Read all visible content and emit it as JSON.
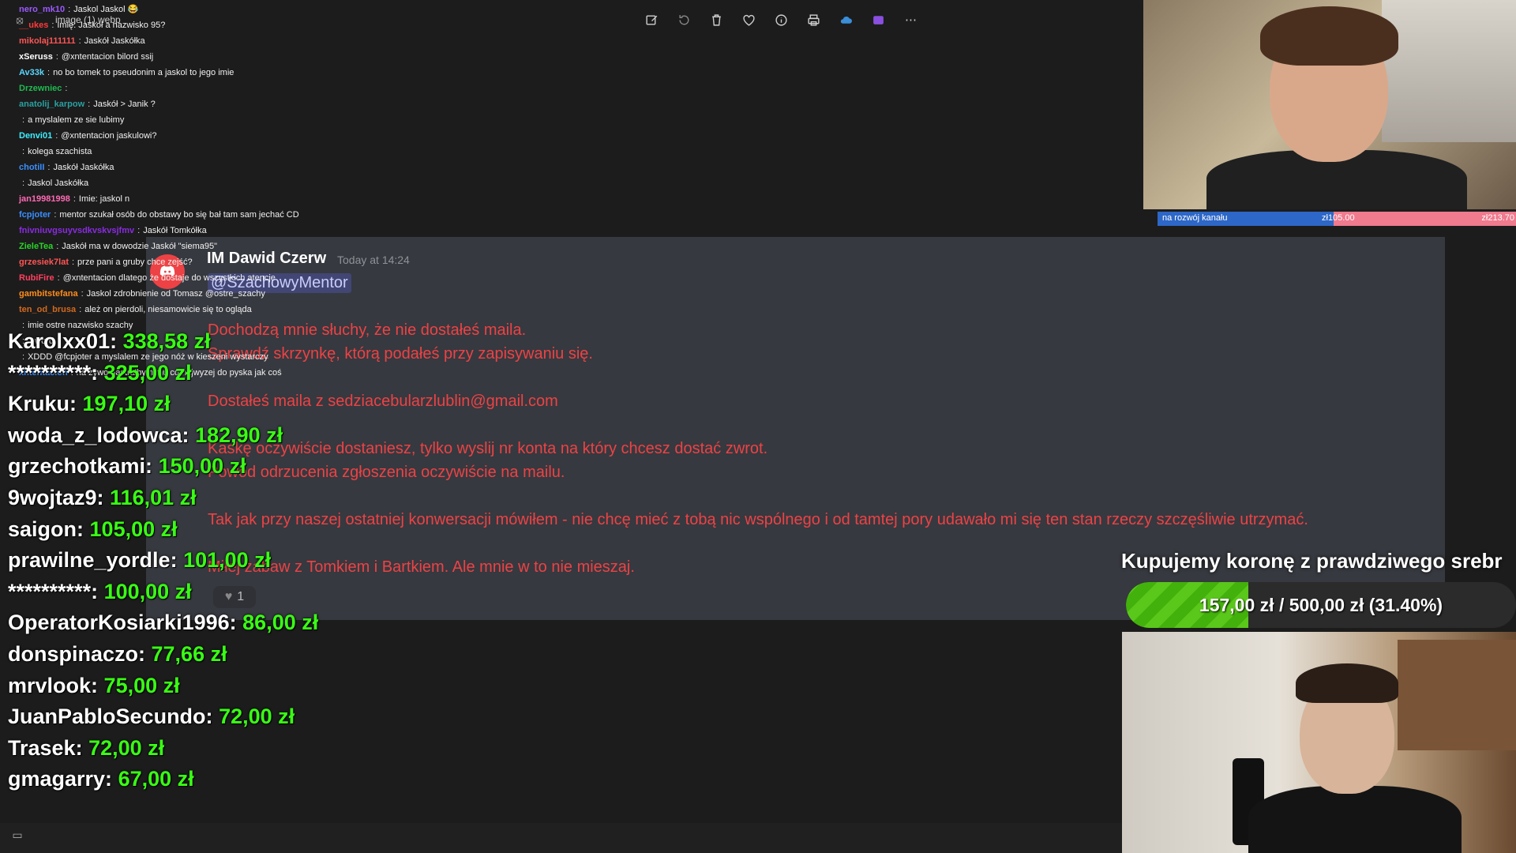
{
  "viewer": {
    "title": "image (1).webp",
    "toolbar": [
      "edit-icon",
      "rotate-icon",
      "delete-icon",
      "favorite-icon",
      "info-icon",
      "print-icon",
      "cloud-icon",
      "clipchamp-icon",
      "more-icon"
    ]
  },
  "chat": {
    "messages": [
      {
        "user": "nero_mk10",
        "text": "Jaskol Jaskol 😂",
        "color": "#9b59ff"
      },
      {
        "user": "__ukes",
        "text": "Imię: Jaskoł a nazwisko 95?",
        "color": "#ff3b3b"
      },
      {
        "user": "mikolaj111111",
        "text": "Jaskół Jaskółka",
        "color": "#ff5555"
      },
      {
        "user": "xSeruss",
        "text": "@xntentacion bilord ssij",
        "color": "#ffffff"
      },
      {
        "user": "Av33k",
        "text": "no bo tomek to pseudonim a jaskol to jego imie",
        "color": "#5ad7ff"
      },
      {
        "user": "Drzewniec",
        "text": "",
        "color": "#1fba4f"
      },
      {
        "user": "anatolij_karpow",
        "text": "Jaskół > Janik ?",
        "color": "#2aa0a0"
      },
      {
        "user": "",
        "text": "a myslalem ze sie lubimy",
        "color": "#3a3ae0"
      },
      {
        "user": "Denvi01",
        "text": "@xntentacion jaskulowi?",
        "color": "#3cf0ff"
      },
      {
        "user": "",
        "text": "kolega szachista",
        "color": "#ff2a2a"
      },
      {
        "user": "chotiII",
        "text": "Jaskół Jaskółka",
        "color": "#3a8fff"
      },
      {
        "user": "",
        "text": "Jaskol Jaskółka",
        "color": "#3a3ae0"
      },
      {
        "user": "jan19981998",
        "text": "Imie: jaskol n",
        "color": "#ff69b4"
      },
      {
        "user": "fcpjoter",
        "text": "mentor szukał osób do obstawy bo się bał tam sam jechać CD",
        "color": "#3a8fff"
      },
      {
        "user": "fnivniuvgsuyvsdkvskvsjfmv",
        "text": "Jaskół Tomkółka",
        "color": "#8a2be2"
      },
      {
        "user": "ZieleTea",
        "text": "Jaskół ma w dowodzie Jaskół \"siema95\"",
        "color": "#2ad42a"
      },
      {
        "user": "grzesiek7lat",
        "text": "prze pani a gruby chce zejść?",
        "color": "#ff5555"
      },
      {
        "user": "RubiFire",
        "text": "@xntentacion dlatego że dostaje do wszystkich atencje",
        "color": "#ff4060"
      },
      {
        "user": "gambitstefana",
        "text": "Jaskol zdrobnienie od Tomasz @ostre_szachy",
        "color": "#ff8c1a"
      },
      {
        "user": "ten_od_brusa",
        "text": "ależ on pierdoli, niesamowicie się to ogląda",
        "color": "#d2691e"
      },
      {
        "user": "",
        "text": "imie ostre nazwisko szachy",
        "color": "#3a3ae0"
      },
      {
        "user": "",
        "text": "J-word",
        "color": "#ff2a8a"
      },
      {
        "user": "",
        "text": "XDDD @fcpjoter a myslalem ze jego nóż w kieszeni wystarczy",
        "color": "#3a3ae0"
      },
      {
        "user": "xntentacion",
        "text": "na żywo nastrałbym mu co najwyzej do pyska jak coś",
        "color": "#3a8fff"
      }
    ]
  },
  "discord": {
    "author": "IM Dawid Czerw",
    "time": "Today at 14:24",
    "mention": "@SzachowyMentor",
    "lines": [
      "Dochodzą mnie słuchy, że nie dostałeś maila.",
      "Sprawdź skrzynkę, którą podałeś przy zapisywaniu się.",
      "Dostałeś maila z sedziacebularzlublin@gmail.com",
      "Kaskę oczywiście dostaniesz, tylko wyslij nr konta na który chcesz dostać zwrot.",
      "Powód odrzucenia zgłoszenia oczywiście na mailu.",
      "Tak jak przy naszej ostatniej konwersacji mówiłem - nie chcę mieć z tobą nic wspólnego i od tamtej pory udawało mi się ten stan rzeczy szczęśliwie utrzymać.",
      "Miłej zabaw z Tomkiem i Bartkiem. Ale mnie w to nie mieszaj."
    ],
    "reaction_count": "1"
  },
  "donors": [
    {
      "name": "Karolxx01:",
      "amount": "338,58 zł"
    },
    {
      "name": "**********:",
      "amount": "325,00 zł"
    },
    {
      "name": "Kruku:",
      "amount": "197,10 zł"
    },
    {
      "name": "woda_z_lodowca:",
      "amount": "182,90 zł"
    },
    {
      "name": "grzechotkami:",
      "amount": "150,00 zł"
    },
    {
      "name": "9wojtaz9:",
      "amount": "116,01 zł"
    },
    {
      "name": "saigon:",
      "amount": "105,00 zł"
    },
    {
      "name": "prawilne_yordle:",
      "amount": "101,00 zł"
    },
    {
      "name": "**********:",
      "amount": "100,00 zł"
    },
    {
      "name": "OperatorKosiarki1996:",
      "amount": "86,00 zł"
    },
    {
      "name": "donspinaczo:",
      "amount": "77,66 zł"
    },
    {
      "name": "mrvlook:",
      "amount": "75,00 zł"
    },
    {
      "name": "JuanPabloSecundo:",
      "amount": "72,00 zł"
    },
    {
      "name": "Trasek:",
      "amount": "72,00 zł"
    },
    {
      "name": "gmagarry:",
      "amount": "67,00 zł"
    }
  ],
  "goal_small": {
    "label": "na rozwój kanału",
    "current": "zł105.00",
    "target": "zł213.70",
    "progress": 0.491
  },
  "goal_big": {
    "title": "Kupujemy koronę z prawdziwego srebr",
    "text": "157,00 zł / 500,00 zł (31.40%)",
    "progress": 0.314
  }
}
